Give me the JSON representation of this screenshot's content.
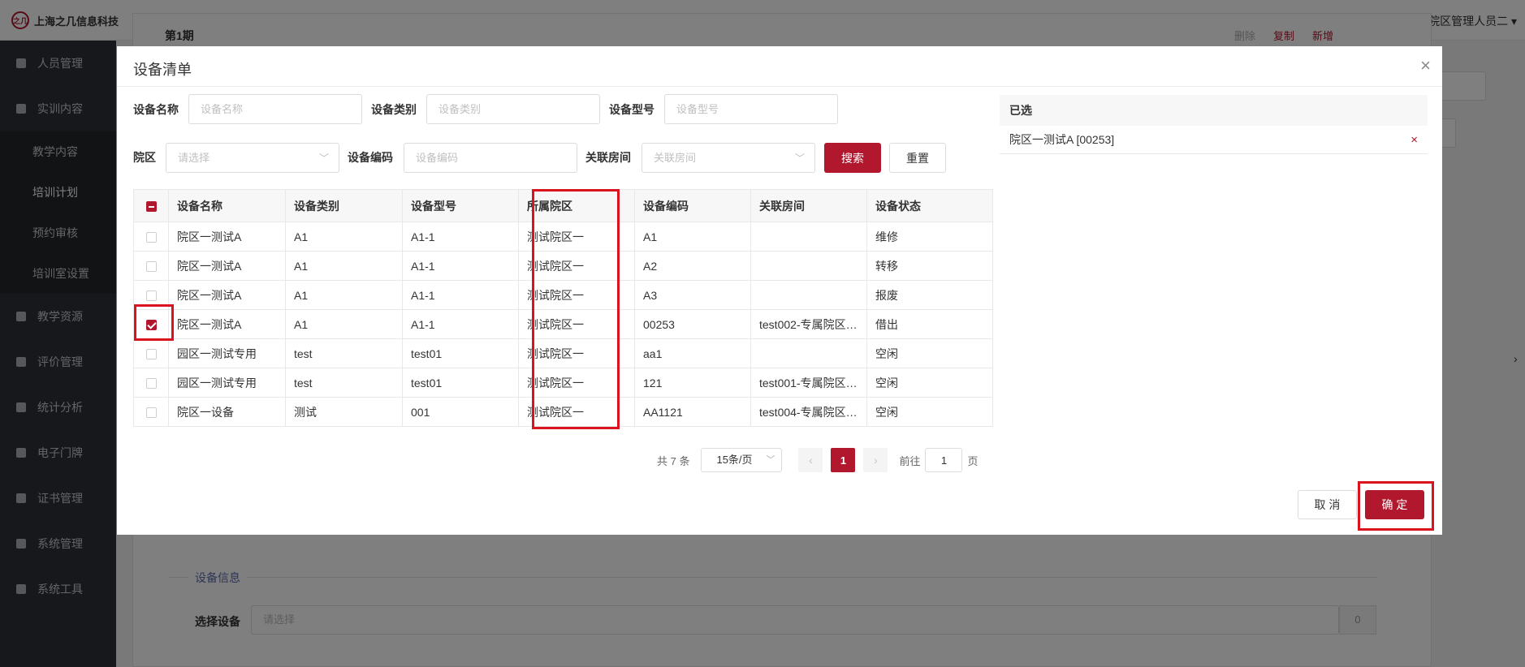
{
  "app": {
    "logo_mark": "之几",
    "logo_text": "上海之几信息科技",
    "user_name": "院区管理人员二 ▾"
  },
  "sidebar": {
    "items": [
      {
        "label": "人员管理",
        "icon": "users-icon"
      },
      {
        "label": "实训内容",
        "icon": "book-icon"
      },
      {
        "label": "教学资源",
        "icon": "resource-icon"
      },
      {
        "label": "评价管理",
        "icon": "rating-icon"
      },
      {
        "label": "统计分析",
        "icon": "chart-icon"
      },
      {
        "label": "电子门牌",
        "icon": "monitor-icon"
      },
      {
        "label": "证书管理",
        "icon": "certificate-icon"
      },
      {
        "label": "系统管理",
        "icon": "gear-icon"
      },
      {
        "label": "系统工具",
        "icon": "toolbox-icon"
      }
    ],
    "subitems": [
      "教学内容",
      "培训计划",
      "预约审核",
      "培训室设置"
    ],
    "active_subitem": "培训计划"
  },
  "background": {
    "issue_title": "第1期",
    "actions": {
      "delete": "删除",
      "copy": "复制",
      "add": "新增"
    },
    "section_title": "设备信息",
    "select_label": "选择设备",
    "select_placeholder": "请选择",
    "select_count": "0"
  },
  "dialog": {
    "title": "设备清单",
    "close": "×",
    "filters": {
      "name_label": "设备名称",
      "name_placeholder": "设备名称",
      "category_label": "设备类别",
      "category_placeholder": "设备类别",
      "model_label": "设备型号",
      "model_placeholder": "设备型号",
      "campus_label": "院区",
      "campus_placeholder": "请选择",
      "code_label": "设备编码",
      "code_placeholder": "设备编码",
      "room_label": "关联房间",
      "room_placeholder": "关联房间",
      "search_button": "搜索",
      "reset_button": "重置"
    },
    "table": {
      "headers": [
        "设备名称",
        "设备类别",
        "设备型号",
        "所属院区",
        "设备编码",
        "关联房间",
        "设备状态"
      ],
      "rows": [
        {
          "checked": false,
          "cells": [
            "院区一测试A",
            "A1",
            "A1-1",
            "测试院区一",
            "A1",
            "",
            "维修"
          ]
        },
        {
          "checked": false,
          "cells": [
            "院区一测试A",
            "A1",
            "A1-1",
            "测试院区一",
            "A2",
            "",
            "转移"
          ]
        },
        {
          "checked": false,
          "cells": [
            "院区一测试A",
            "A1",
            "A1-1",
            "测试院区一",
            "A3",
            "",
            "报废"
          ]
        },
        {
          "checked": true,
          "cells": [
            "院区一测试A",
            "A1",
            "A1-1",
            "测试院区一",
            "00253",
            "test002-专属院区…",
            "借出"
          ]
        },
        {
          "checked": false,
          "cells": [
            "园区一测试专用",
            "test",
            "test01",
            "测试院区一",
            "aa1",
            "",
            "空闲"
          ]
        },
        {
          "checked": false,
          "cells": [
            "园区一测试专用",
            "test",
            "test01",
            "测试院区一",
            "121",
            "test001-专属院区…",
            "空闲"
          ]
        },
        {
          "checked": false,
          "cells": [
            "院区一设备",
            "测试",
            "001",
            "测试院区一",
            "AA1121",
            "test004-专属院区…",
            "空闲"
          ]
        }
      ]
    },
    "pagination": {
      "total": "共 7 条",
      "page_size": "15条/页",
      "prev": "‹",
      "current": "1",
      "next": "›",
      "goto_label": "前往",
      "goto_value": "1",
      "goto_unit": "页"
    },
    "selected": {
      "title": "已选",
      "items": [
        {
          "label": "院区一测试A [00253]",
          "remove": "×"
        }
      ]
    },
    "cancel_button": "取 消",
    "ok_button": "确 定"
  },
  "colors": {
    "accent": "#b1172d",
    "highlight": "#d9141e",
    "sidebar_bg": "#2e3138"
  }
}
